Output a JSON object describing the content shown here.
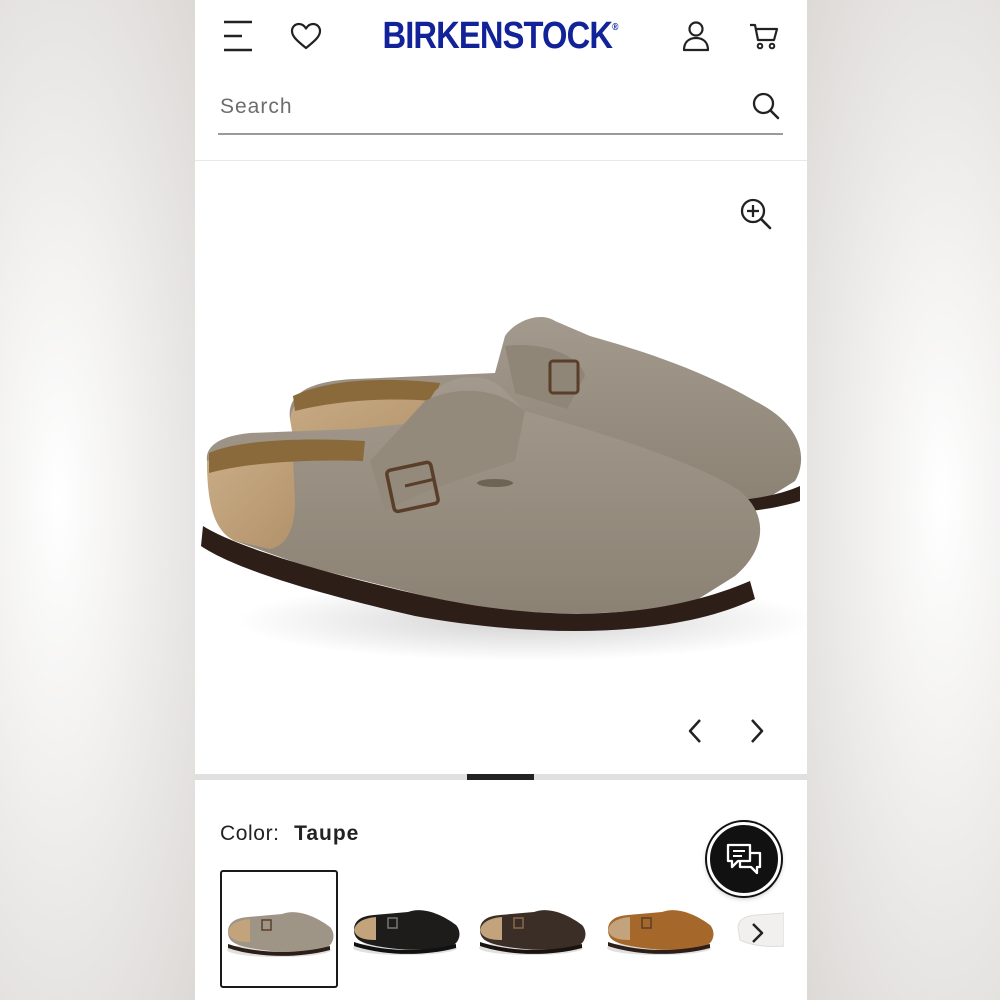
{
  "header": {
    "brand": "BIRKENSTOCK",
    "brand_color": "#12239a",
    "icons": [
      "menu-icon",
      "heart-icon",
      "account-icon",
      "cart-icon"
    ]
  },
  "search": {
    "placeholder": "Search",
    "icon": "search-icon"
  },
  "gallery": {
    "zoom_icon": "zoom-in-icon",
    "prev_icon": "chevron-left-icon",
    "next_icon": "chevron-right-icon",
    "product_image": "taupe-suede-clog-pair"
  },
  "color": {
    "label": "Color:",
    "value": "Taupe"
  },
  "swatches": [
    {
      "name": "taupe",
      "selected": true
    },
    {
      "name": "black"
    },
    {
      "name": "mocha"
    },
    {
      "name": "mink"
    },
    {
      "name": "white"
    }
  ],
  "chat": {
    "icon": "chat-bubbles-icon"
  }
}
